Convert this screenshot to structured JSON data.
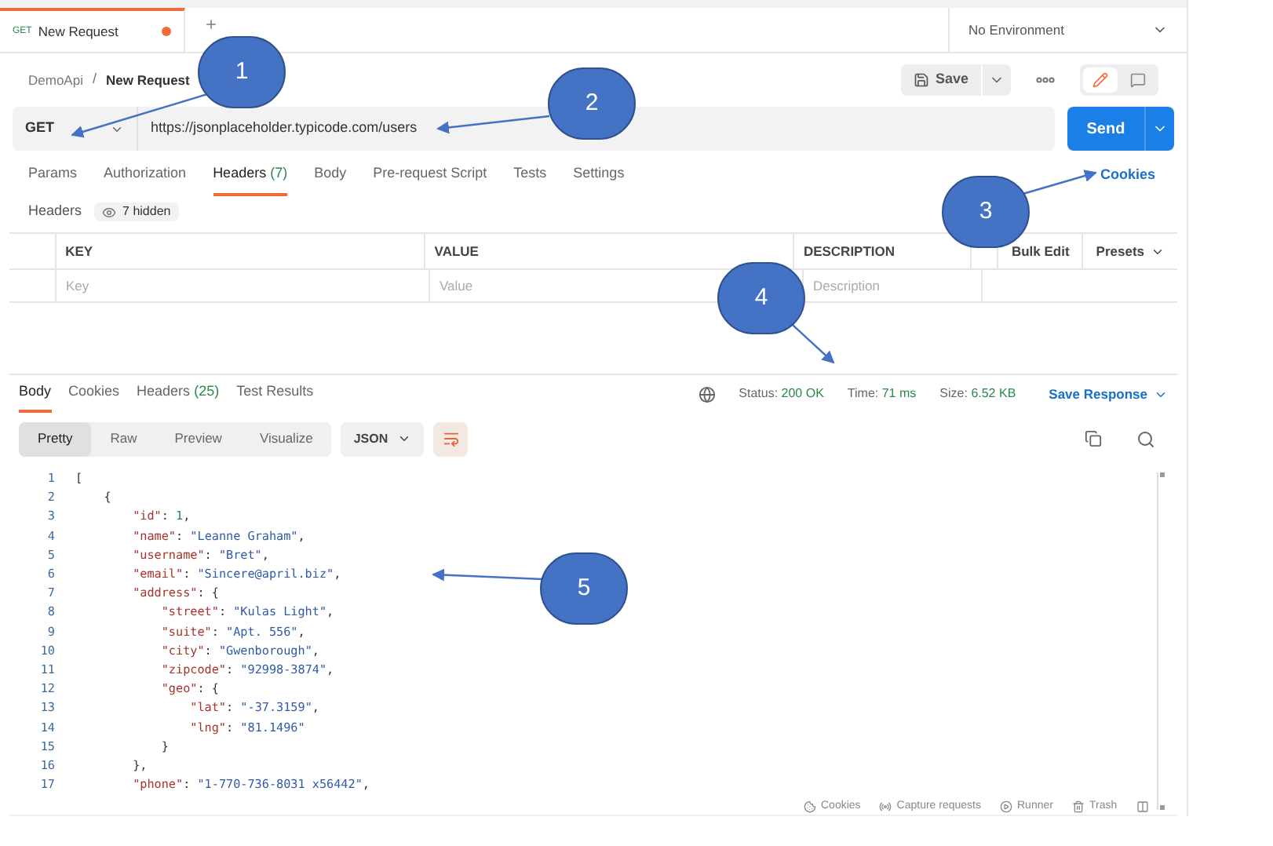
{
  "tabs": [
    {
      "method": "GET",
      "title": "New Request",
      "unsaved": true,
      "selected": true
    }
  ],
  "environment": {
    "value": "No Environment"
  },
  "breadcrumb": {
    "collection": "DemoApi",
    "separator": "/",
    "request": "New Request"
  },
  "save_button": "Save",
  "request": {
    "method": "GET",
    "url": "https://jsonplaceholder.typicode.com/users",
    "send": "Send"
  },
  "request_tabs": [
    {
      "label": "Params",
      "selected": false
    },
    {
      "label": "Authorization",
      "selected": false
    },
    {
      "label": "Headers",
      "count": "(7)",
      "selected": true
    },
    {
      "label": "Body",
      "selected": false
    },
    {
      "label": "Pre-request Script",
      "selected": false
    },
    {
      "label": "Tests",
      "selected": false
    },
    {
      "label": "Settings",
      "selected": false
    }
  ],
  "cookies_link": "Cookies",
  "headers_bar": {
    "label": "Headers",
    "hidden": "7 hidden"
  },
  "headers_table": {
    "columns": [
      "KEY",
      "VALUE",
      "DESCRIPTION"
    ],
    "actions": [
      "Bulk Edit",
      "Presets"
    ],
    "placeholders": [
      "Key",
      "Value",
      "Description"
    ]
  },
  "response_tabs": [
    {
      "label": "Body",
      "selected": true
    },
    {
      "label": "Cookies",
      "selected": false
    },
    {
      "label": "Headers",
      "count": "(25)",
      "selected": false
    },
    {
      "label": "Test Results",
      "selected": false
    }
  ],
  "response_meta": [
    {
      "label": "Status:",
      "value": "200 OK"
    },
    {
      "label": "Time:",
      "value": "71 ms"
    },
    {
      "label": "Size:",
      "value": "6.52 KB"
    }
  ],
  "save_response": "Save Response",
  "view_modes": [
    {
      "label": "Pretty",
      "selected": true
    },
    {
      "label": "Raw",
      "selected": false
    },
    {
      "label": "Preview",
      "selected": false
    },
    {
      "label": "Visualize",
      "selected": false
    }
  ],
  "format": "JSON",
  "code_lines": [
    {
      "number": "1",
      "tokens": [
        {
          "kind": "punct",
          "text": "["
        }
      ]
    },
    {
      "number": "2",
      "tokens": [
        {
          "kind": "punct",
          "text": "    {"
        }
      ]
    },
    {
      "number": "3",
      "tokens": [
        {
          "kind": "key",
          "text": "        \"id\""
        },
        {
          "kind": "punct",
          "text": ": "
        },
        {
          "kind": "number",
          "text": "1"
        },
        {
          "kind": "punct",
          "text": ","
        }
      ]
    },
    {
      "number": "4",
      "tokens": [
        {
          "kind": "key",
          "text": "        \"name\""
        },
        {
          "kind": "punct",
          "text": ": "
        },
        {
          "kind": "string",
          "text": "\"Leanne Graham\""
        },
        {
          "kind": "punct",
          "text": ","
        }
      ]
    },
    {
      "number": "5",
      "tokens": [
        {
          "kind": "key",
          "text": "        \"username\""
        },
        {
          "kind": "punct",
          "text": ": "
        },
        {
          "kind": "string",
          "text": "\"Bret\""
        },
        {
          "kind": "punct",
          "text": ","
        }
      ]
    },
    {
      "number": "6",
      "tokens": [
        {
          "kind": "key",
          "text": "        \"email\""
        },
        {
          "kind": "punct",
          "text": ": "
        },
        {
          "kind": "string",
          "text": "\"Sincere@april.biz\""
        },
        {
          "kind": "punct",
          "text": ","
        }
      ]
    },
    {
      "number": "7",
      "tokens": [
        {
          "kind": "key",
          "text": "        \"address\""
        },
        {
          "kind": "punct",
          "text": ": {"
        }
      ]
    },
    {
      "number": "8",
      "tokens": [
        {
          "kind": "key",
          "text": "            \"street\""
        },
        {
          "kind": "punct",
          "text": ": "
        },
        {
          "kind": "string",
          "text": "\"Kulas Light\""
        },
        {
          "kind": "punct",
          "text": ","
        }
      ]
    },
    {
      "number": "9",
      "tokens": [
        {
          "kind": "key",
          "text": "            \"suite\""
        },
        {
          "kind": "punct",
          "text": ": "
        },
        {
          "kind": "string",
          "text": "\"Apt. 556\""
        },
        {
          "kind": "punct",
          "text": ","
        }
      ]
    },
    {
      "number": "10",
      "tokens": [
        {
          "kind": "key",
          "text": "            \"city\""
        },
        {
          "kind": "punct",
          "text": ": "
        },
        {
          "kind": "string",
          "text": "\"Gwenborough\""
        },
        {
          "kind": "punct",
          "text": ","
        }
      ]
    },
    {
      "number": "11",
      "tokens": [
        {
          "kind": "key",
          "text": "            \"zipcode\""
        },
        {
          "kind": "punct",
          "text": ": "
        },
        {
          "kind": "string",
          "text": "\"92998-3874\""
        },
        {
          "kind": "punct",
          "text": ","
        }
      ]
    },
    {
      "number": "12",
      "tokens": [
        {
          "kind": "key",
          "text": "            \"geo\""
        },
        {
          "kind": "punct",
          "text": ": {"
        }
      ]
    },
    {
      "number": "13",
      "tokens": [
        {
          "kind": "key",
          "text": "                \"lat\""
        },
        {
          "kind": "punct",
          "text": ": "
        },
        {
          "kind": "string",
          "text": "\"-37.3159\""
        },
        {
          "kind": "punct",
          "text": ","
        }
      ]
    },
    {
      "number": "14",
      "tokens": [
        {
          "kind": "key",
          "text": "                \"lng\""
        },
        {
          "kind": "punct",
          "text": ": "
        },
        {
          "kind": "string",
          "text": "\"81.1496\""
        }
      ]
    },
    {
      "number": "15",
      "tokens": [
        {
          "kind": "punct",
          "text": "            }"
        }
      ]
    },
    {
      "number": "16",
      "tokens": [
        {
          "kind": "punct",
          "text": "        },"
        }
      ]
    },
    {
      "number": "17",
      "tokens": [
        {
          "kind": "key",
          "text": "        \"phone\""
        },
        {
          "kind": "punct",
          "text": ": "
        },
        {
          "kind": "string",
          "text": "\"1-770-736-8031 x56442\""
        },
        {
          "kind": "punct",
          "text": ","
        }
      ]
    }
  ],
  "footer": [
    "Cookies",
    "Capture requests",
    "Runner",
    "Trash"
  ],
  "callouts": [
    {
      "number": "1"
    },
    {
      "number": "2"
    },
    {
      "number": "3"
    },
    {
      "number": "4"
    },
    {
      "number": "5"
    }
  ]
}
